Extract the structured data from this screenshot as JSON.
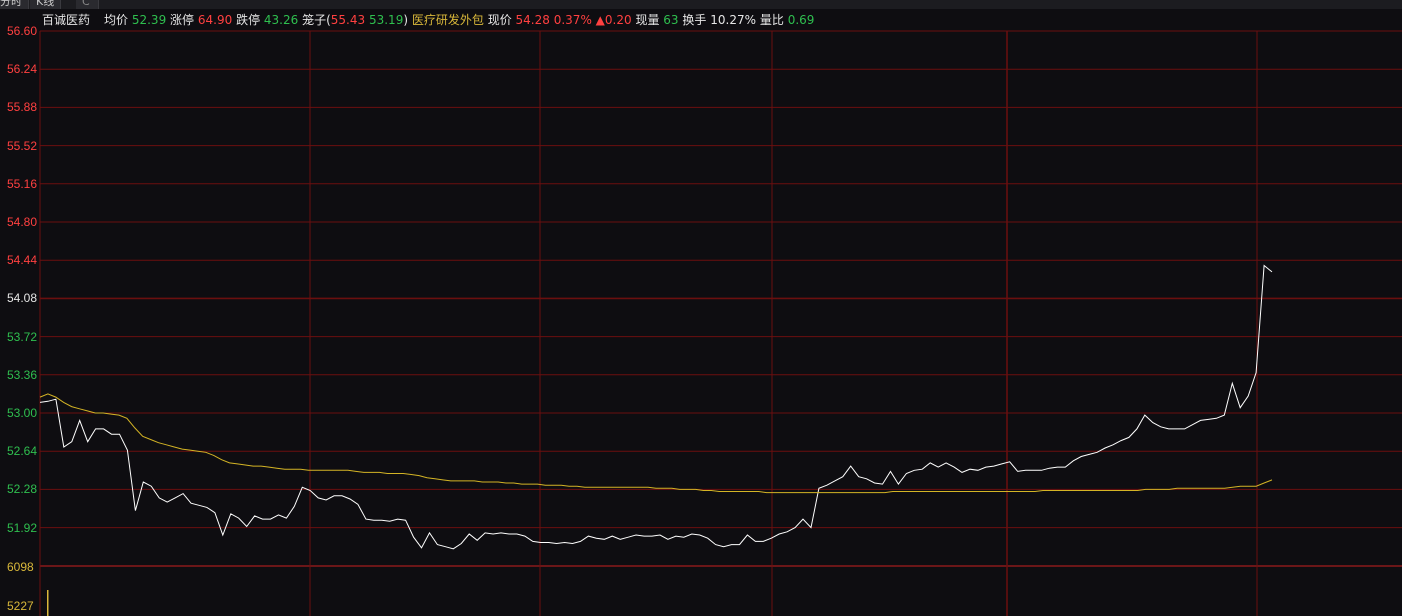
{
  "tabs": [
    {
      "label": "分时"
    },
    {
      "label": "K线"
    },
    {
      "label": "C"
    }
  ],
  "info": {
    "name": "百诚医药",
    "avg_label": "均价",
    "avg_value": "52.39",
    "limit_up_label": "涨停",
    "limit_up_value": "64.90",
    "limit_down_label": "跌停",
    "limit_down_value": "43.26",
    "cage_label": "笼子(",
    "cage_high": "55.43",
    "cage_low": "53.19",
    "cage_close": ")",
    "sector": "医疗研发外包",
    "price_label": "现价",
    "price_value": "54.28",
    "change_pct": "0.37%",
    "change_value": "▲0.20",
    "volume_label": "现量",
    "volume_value": "63",
    "turnover_label": "换手",
    "turnover_value": "10.27%",
    "volume_ratio_label": "量比",
    "volume_ratio_value": "0.69"
  },
  "colors": {
    "up": "#ff4040",
    "down": "#2fbf4f",
    "neutral": "#e6e6e6",
    "sector": "#d9b83a",
    "price_line": "#ffffff",
    "avg_line": "#d4b425",
    "grid": "#6b0f0f",
    "volume_label": "#d9b83a"
  },
  "price_axis": {
    "labels": [
      {
        "value": "56.60",
        "tone": "up"
      },
      {
        "value": "56.24",
        "tone": "up"
      },
      {
        "value": "55.88",
        "tone": "up"
      },
      {
        "value": "55.52",
        "tone": "up"
      },
      {
        "value": "55.16",
        "tone": "up"
      },
      {
        "value": "54.80",
        "tone": "up"
      },
      {
        "value": "54.44",
        "tone": "up"
      },
      {
        "value": "54.08",
        "tone": "neutral"
      },
      {
        "value": "53.72",
        "tone": "down"
      },
      {
        "value": "53.36",
        "tone": "down"
      },
      {
        "value": "53.00",
        "tone": "down"
      },
      {
        "value": "52.64",
        "tone": "down"
      },
      {
        "value": "52.28",
        "tone": "down"
      },
      {
        "value": "51.92",
        "tone": "down"
      }
    ]
  },
  "volume_axis": {
    "labels": [
      "6098",
      "5227"
    ]
  },
  "chart_data": {
    "type": "line",
    "ylim": [
      51.74,
      56.6
    ],
    "series": [
      {
        "values": [
          53.1,
          53.11,
          53.13,
          52.68,
          52.73,
          52.93,
          52.73,
          52.85,
          52.85,
          52.8,
          52.8,
          52.65,
          52.08,
          52.35,
          52.31,
          52.2,
          52.16,
          52.2,
          52.24,
          52.15,
          52.13,
          52.11,
          52.06,
          51.85,
          52.05,
          52.01,
          51.93,
          52.03,
          52.0,
          52.0,
          52.04,
          52.01,
          52.12,
          52.3,
          52.27,
          52.2,
          52.18,
          52.22,
          52.22,
          52.19,
          52.14,
          52.0,
          51.99,
          51.99,
          51.98,
          52.0,
          51.99,
          51.83,
          51.73,
          51.87,
          51.76,
          51.74,
          51.72,
          51.77,
          51.86,
          51.8,
          51.87,
          51.86,
          51.87,
          51.86,
          51.86,
          51.84,
          51.79,
          51.78,
          51.78,
          51.77,
          51.78,
          51.77,
          51.79,
          51.84,
          51.82,
          51.81,
          51.84,
          51.81,
          51.83,
          51.85,
          51.84,
          51.84,
          51.85,
          51.81,
          51.84,
          51.83,
          51.86,
          51.85,
          51.82,
          51.76,
          51.74,
          51.76,
          51.76,
          51.85,
          51.79,
          51.79,
          51.82,
          51.86,
          51.88,
          51.92,
          52.0,
          51.92,
          52.29,
          52.32,
          52.36,
          52.4,
          52.5,
          52.4,
          52.38,
          52.34,
          52.33,
          52.45,
          52.33,
          52.43,
          52.46,
          52.47,
          52.53,
          52.49,
          52.53,
          52.49,
          52.44,
          52.47,
          52.46,
          52.49,
          52.5,
          52.52,
          52.54,
          52.45,
          52.46,
          52.46,
          52.46,
          52.48,
          52.49,
          52.49,
          52.55,
          52.59,
          52.61,
          52.63,
          52.67,
          52.7,
          52.74,
          52.77,
          52.85,
          52.98,
          52.91,
          52.87,
          52.85,
          52.85,
          52.85,
          52.89,
          52.93,
          52.94,
          52.95,
          52.98,
          53.28,
          53.05,
          53.16,
          53.38,
          54.39,
          54.33
        ]
      },
      {
        "values": [
          53.15,
          53.18,
          53.15,
          53.1,
          53.06,
          53.04,
          53.02,
          53.0,
          53.0,
          52.99,
          52.98,
          52.95,
          52.86,
          52.78,
          52.75,
          52.72,
          52.7,
          52.68,
          52.66,
          52.65,
          52.64,
          52.63,
          52.6,
          52.56,
          52.53,
          52.52,
          52.51,
          52.5,
          52.5,
          52.49,
          52.48,
          52.47,
          52.47,
          52.47,
          52.46,
          52.46,
          52.46,
          52.46,
          52.46,
          52.46,
          52.45,
          52.44,
          52.44,
          52.44,
          52.43,
          52.43,
          52.43,
          52.42,
          52.41,
          52.39,
          52.38,
          52.37,
          52.36,
          52.36,
          52.36,
          52.36,
          52.35,
          52.35,
          52.35,
          52.34,
          52.34,
          52.33,
          52.33,
          52.33,
          52.32,
          52.32,
          52.32,
          52.31,
          52.31,
          52.3,
          52.3,
          52.3,
          52.3,
          52.3,
          52.3,
          52.3,
          52.3,
          52.3,
          52.29,
          52.29,
          52.29,
          52.28,
          52.28,
          52.28,
          52.27,
          52.27,
          52.26,
          52.26,
          52.26,
          52.26,
          52.26,
          52.26,
          52.25,
          52.25,
          52.25,
          52.25,
          52.25,
          52.25,
          52.25,
          52.25,
          52.25,
          52.25,
          52.25,
          52.25,
          52.25,
          52.25,
          52.25,
          52.25,
          52.26,
          52.26,
          52.26,
          52.26,
          52.26,
          52.26,
          52.26,
          52.26,
          52.26,
          52.26,
          52.26,
          52.26,
          52.26,
          52.26,
          52.26,
          52.26,
          52.26,
          52.26,
          52.26,
          52.27,
          52.27,
          52.27,
          52.27,
          52.27,
          52.27,
          52.27,
          52.27,
          52.27,
          52.27,
          52.27,
          52.27,
          52.27,
          52.28,
          52.28,
          52.28,
          52.28,
          52.29,
          52.29,
          52.29,
          52.29,
          52.29,
          52.29,
          52.29,
          52.3,
          52.31,
          52.31,
          52.31,
          52.34,
          52.37
        ]
      }
    ]
  }
}
